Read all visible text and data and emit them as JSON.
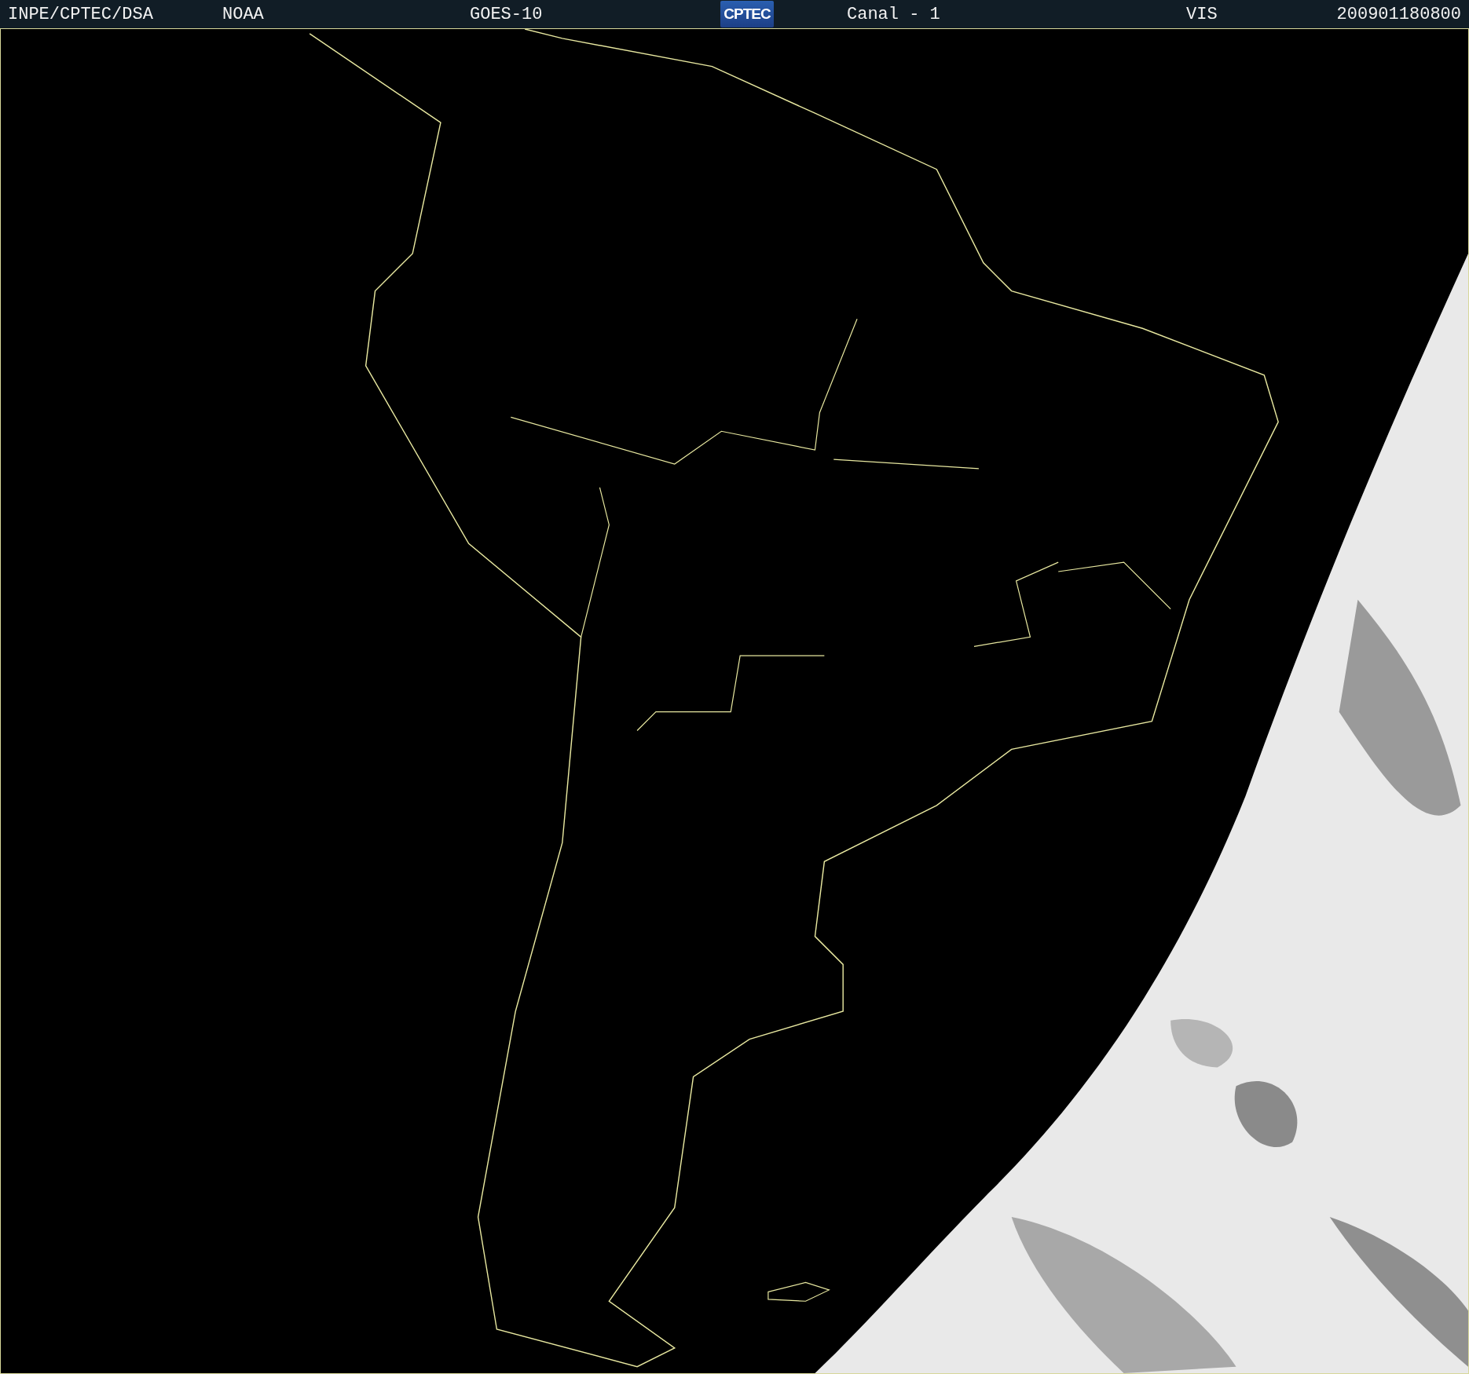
{
  "header": {
    "source": "INPE/CPTEC/DSA",
    "agency": "NOAA",
    "satellite": "GOES-10",
    "logo": "CPTEC",
    "channel": "Canal - 1",
    "band": "VIS",
    "timestamp": "200901180800"
  }
}
